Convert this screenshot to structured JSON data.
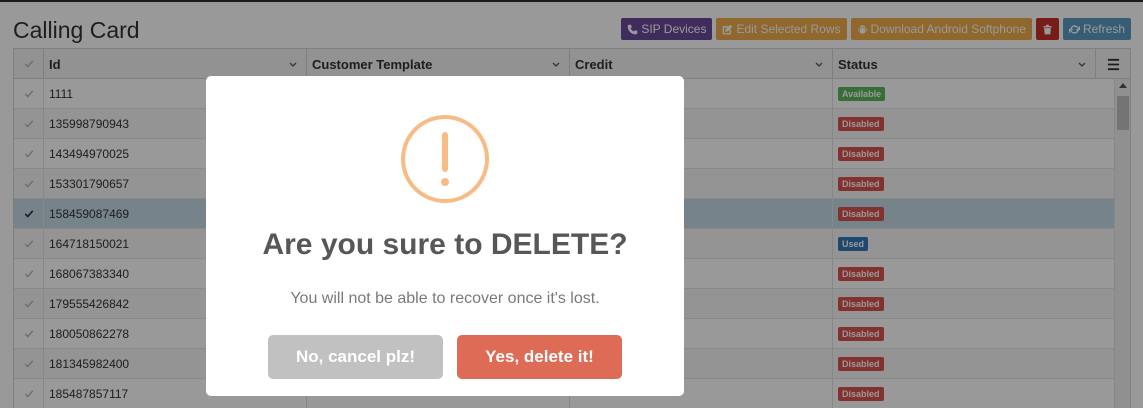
{
  "page": {
    "title": "Calling Card"
  },
  "toolbar": {
    "sip_devices": "SIP Devices",
    "edit_selected_rows": "Edit Selected Rows",
    "download_android": "Download Android Softphone",
    "refresh": "Refresh"
  },
  "grid": {
    "columns": [
      "Id",
      "Customer Template",
      "Credit",
      "Status"
    ],
    "rows": [
      {
        "id": "1111",
        "template": "",
        "credit": "",
        "status": "Available",
        "checked": false
      },
      {
        "id": "135998790943",
        "template": "",
        "credit": "",
        "status": "Disabled",
        "checked": false
      },
      {
        "id": "143494970025",
        "template": "",
        "credit": "",
        "status": "Disabled",
        "checked": false
      },
      {
        "id": "153301790657",
        "template": "",
        "credit": "",
        "status": "Disabled",
        "checked": false
      },
      {
        "id": "158459087469",
        "template": "",
        "credit": "",
        "status": "Disabled",
        "checked": true
      },
      {
        "id": "164718150021",
        "template": "",
        "credit": "",
        "status": "Used",
        "checked": false
      },
      {
        "id": "168067383340",
        "template": "",
        "credit": "",
        "status": "Disabled",
        "checked": false
      },
      {
        "id": "179555426842",
        "template": "",
        "credit": "",
        "status": "Disabled",
        "checked": false
      },
      {
        "id": "180050862278",
        "template": "",
        "credit": "",
        "status": "Disabled",
        "checked": false
      },
      {
        "id": "181345982400",
        "template": "",
        "credit": "",
        "status": "Disabled",
        "checked": false
      },
      {
        "id": "185487857117",
        "template": "",
        "credit": "",
        "status": "Disabled",
        "checked": false
      }
    ]
  },
  "dialog": {
    "title": "Are you sure to DELETE?",
    "text": "You will not be able to recover once it's lost.",
    "cancel": "No, cancel plz!",
    "confirm": "Yes, delete it!"
  },
  "colors": {
    "confirm": "#dd6b55",
    "cancel": "#c1c1c1",
    "warning_icon": "#f8bb86",
    "sip_button": "#6b4a9a",
    "edit_button": "#f0ad4e",
    "delete_button": "#c9302c",
    "refresh_button": "#5b9bc2"
  },
  "icons": {
    "sip_devices": "phone-icon",
    "edit": "edit-icon",
    "android": "android-icon",
    "delete": "trash-icon",
    "refresh": "refresh-icon",
    "dialog": "warning-icon"
  }
}
